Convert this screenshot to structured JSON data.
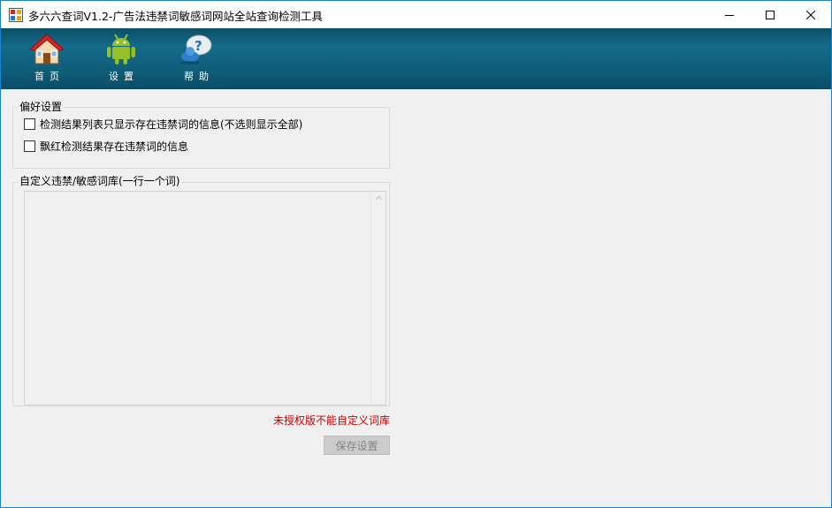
{
  "window": {
    "title": "多六六查词V1.2-广告法违禁词敏感词网站全站查询检测工具",
    "controls": {
      "minimize": "minimize-icon",
      "maximize": "maximize-icon",
      "close": "close-icon"
    }
  },
  "toolbar": {
    "items": [
      {
        "label": "首页",
        "icon": "home-icon"
      },
      {
        "label": "设置",
        "icon": "android-icon"
      },
      {
        "label": "帮助",
        "icon": "help-icon"
      }
    ]
  },
  "preferences": {
    "title": "偏好设置",
    "options": [
      {
        "label": "检测结果列表只显示存在违禁词的信息(不选则显示全部)",
        "checked": false
      },
      {
        "label": "飘红检测结果存在违禁词的信息",
        "checked": false
      }
    ]
  },
  "custom_words": {
    "title": "自定义违禁/敏感词库(一行一个词)",
    "value": ""
  },
  "warning": "未授权版不能自定义词库",
  "save_button": "保存设置",
  "colors": {
    "toolbar": "#0f5d79",
    "warning": "#cc0000",
    "window_border": "#1883d7"
  }
}
